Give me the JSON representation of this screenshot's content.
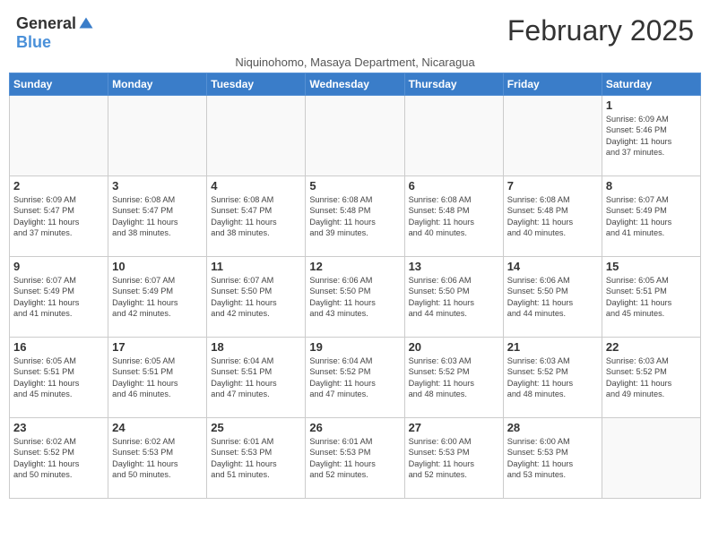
{
  "logo": {
    "general": "General",
    "blue": "Blue"
  },
  "title": "February 2025",
  "subtitle": "Niquinohomo, Masaya Department, Nicaragua",
  "weekdays": [
    "Sunday",
    "Monday",
    "Tuesday",
    "Wednesday",
    "Thursday",
    "Friday",
    "Saturday"
  ],
  "weeks": [
    [
      {
        "day": "",
        "info": ""
      },
      {
        "day": "",
        "info": ""
      },
      {
        "day": "",
        "info": ""
      },
      {
        "day": "",
        "info": ""
      },
      {
        "day": "",
        "info": ""
      },
      {
        "day": "",
        "info": ""
      },
      {
        "day": "1",
        "info": "Sunrise: 6:09 AM\nSunset: 5:46 PM\nDaylight: 11 hours\nand 37 minutes."
      }
    ],
    [
      {
        "day": "2",
        "info": "Sunrise: 6:09 AM\nSunset: 5:47 PM\nDaylight: 11 hours\nand 37 minutes."
      },
      {
        "day": "3",
        "info": "Sunrise: 6:08 AM\nSunset: 5:47 PM\nDaylight: 11 hours\nand 38 minutes."
      },
      {
        "day": "4",
        "info": "Sunrise: 6:08 AM\nSunset: 5:47 PM\nDaylight: 11 hours\nand 38 minutes."
      },
      {
        "day": "5",
        "info": "Sunrise: 6:08 AM\nSunset: 5:48 PM\nDaylight: 11 hours\nand 39 minutes."
      },
      {
        "day": "6",
        "info": "Sunrise: 6:08 AM\nSunset: 5:48 PM\nDaylight: 11 hours\nand 40 minutes."
      },
      {
        "day": "7",
        "info": "Sunrise: 6:08 AM\nSunset: 5:48 PM\nDaylight: 11 hours\nand 40 minutes."
      },
      {
        "day": "8",
        "info": "Sunrise: 6:07 AM\nSunset: 5:49 PM\nDaylight: 11 hours\nand 41 minutes."
      }
    ],
    [
      {
        "day": "9",
        "info": "Sunrise: 6:07 AM\nSunset: 5:49 PM\nDaylight: 11 hours\nand 41 minutes."
      },
      {
        "day": "10",
        "info": "Sunrise: 6:07 AM\nSunset: 5:49 PM\nDaylight: 11 hours\nand 42 minutes."
      },
      {
        "day": "11",
        "info": "Sunrise: 6:07 AM\nSunset: 5:50 PM\nDaylight: 11 hours\nand 42 minutes."
      },
      {
        "day": "12",
        "info": "Sunrise: 6:06 AM\nSunset: 5:50 PM\nDaylight: 11 hours\nand 43 minutes."
      },
      {
        "day": "13",
        "info": "Sunrise: 6:06 AM\nSunset: 5:50 PM\nDaylight: 11 hours\nand 44 minutes."
      },
      {
        "day": "14",
        "info": "Sunrise: 6:06 AM\nSunset: 5:50 PM\nDaylight: 11 hours\nand 44 minutes."
      },
      {
        "day": "15",
        "info": "Sunrise: 6:05 AM\nSunset: 5:51 PM\nDaylight: 11 hours\nand 45 minutes."
      }
    ],
    [
      {
        "day": "16",
        "info": "Sunrise: 6:05 AM\nSunset: 5:51 PM\nDaylight: 11 hours\nand 45 minutes."
      },
      {
        "day": "17",
        "info": "Sunrise: 6:05 AM\nSunset: 5:51 PM\nDaylight: 11 hours\nand 46 minutes."
      },
      {
        "day": "18",
        "info": "Sunrise: 6:04 AM\nSunset: 5:51 PM\nDaylight: 11 hours\nand 47 minutes."
      },
      {
        "day": "19",
        "info": "Sunrise: 6:04 AM\nSunset: 5:52 PM\nDaylight: 11 hours\nand 47 minutes."
      },
      {
        "day": "20",
        "info": "Sunrise: 6:03 AM\nSunset: 5:52 PM\nDaylight: 11 hours\nand 48 minutes."
      },
      {
        "day": "21",
        "info": "Sunrise: 6:03 AM\nSunset: 5:52 PM\nDaylight: 11 hours\nand 48 minutes."
      },
      {
        "day": "22",
        "info": "Sunrise: 6:03 AM\nSunset: 5:52 PM\nDaylight: 11 hours\nand 49 minutes."
      }
    ],
    [
      {
        "day": "23",
        "info": "Sunrise: 6:02 AM\nSunset: 5:52 PM\nDaylight: 11 hours\nand 50 minutes."
      },
      {
        "day": "24",
        "info": "Sunrise: 6:02 AM\nSunset: 5:53 PM\nDaylight: 11 hours\nand 50 minutes."
      },
      {
        "day": "25",
        "info": "Sunrise: 6:01 AM\nSunset: 5:53 PM\nDaylight: 11 hours\nand 51 minutes."
      },
      {
        "day": "26",
        "info": "Sunrise: 6:01 AM\nSunset: 5:53 PM\nDaylight: 11 hours\nand 52 minutes."
      },
      {
        "day": "27",
        "info": "Sunrise: 6:00 AM\nSunset: 5:53 PM\nDaylight: 11 hours\nand 52 minutes."
      },
      {
        "day": "28",
        "info": "Sunrise: 6:00 AM\nSunset: 5:53 PM\nDaylight: 11 hours\nand 53 minutes."
      },
      {
        "day": "",
        "info": ""
      }
    ]
  ]
}
